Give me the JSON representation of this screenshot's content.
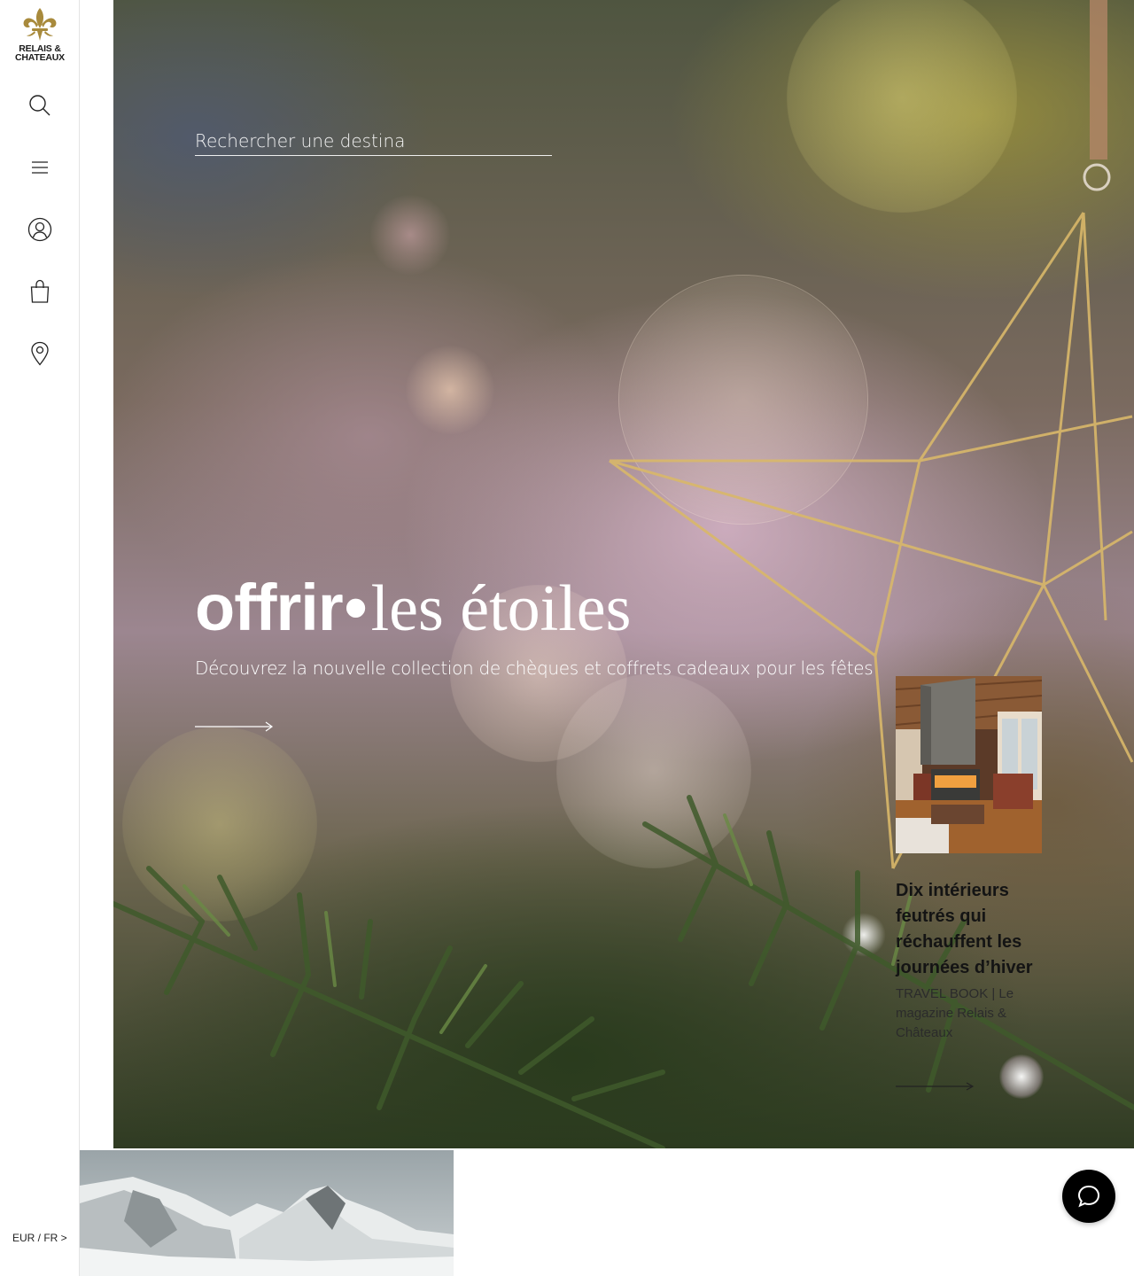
{
  "brand": {
    "line1": "RELAIS &",
    "line2": "CHATEAUX",
    "gold": "#a88a3c"
  },
  "sidebar": {
    "icons": [
      "search-icon",
      "menu-icon",
      "account-icon",
      "shopping-bag-icon",
      "location-pin-icon"
    ],
    "currency_locale": "EUR / FR >"
  },
  "hero": {
    "search_placeholder": "Rechercher une destina",
    "title_bold": "offrir",
    "title_dot": "•",
    "title_serif": "les étoiles",
    "subtitle": "Découvrez la nouvelle collection de chèques et coffrets cadeaux pour les fêtes"
  },
  "article": {
    "title": "Dix intérieurs feutrés qui réchauffent les journées d’hiver",
    "meta": "TRAVEL BOOK | Le magazine Relais & Châteaux"
  },
  "chat": {
    "icon": "chat-bubble-icon"
  }
}
